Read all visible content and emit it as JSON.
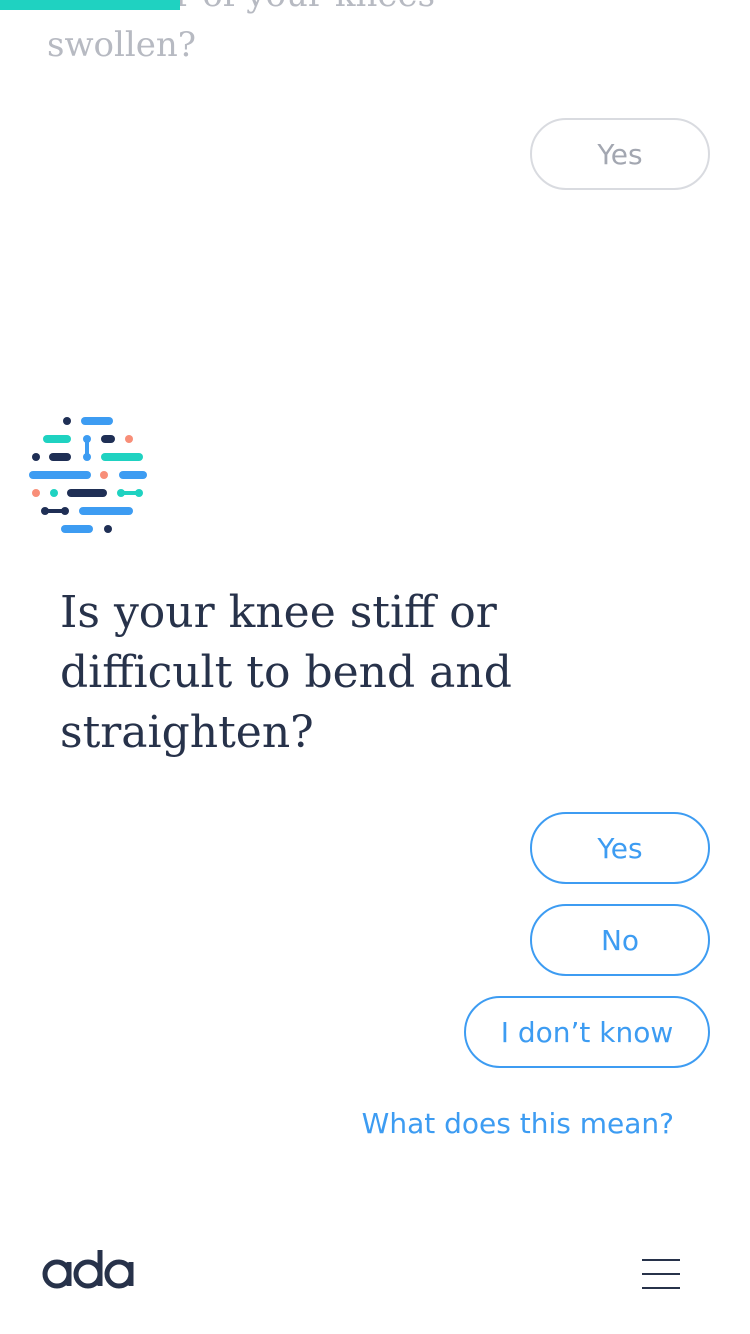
{
  "progress": {
    "value_percent": 24,
    "color": "#1fd2c1"
  },
  "previous": {
    "question": "Is either of your knees swollen?",
    "answer": "Yes"
  },
  "current": {
    "question": "Is your knee stiff or difficult to bend and straighten?",
    "answers": {
      "yes": "Yes",
      "no": "No",
      "dont_know": "I don’t know"
    },
    "help_link": "What does this mean?"
  },
  "footer": {
    "logo_text": "ada",
    "menu_icon": "hamburger-menu-icon"
  },
  "colors": {
    "accent": "#3d9cf2",
    "text_primary": "#27324a",
    "text_muted": "#b7bac2",
    "teal": "#1fd2c1",
    "coral": "#f88e78",
    "navy": "#1f2f55"
  }
}
